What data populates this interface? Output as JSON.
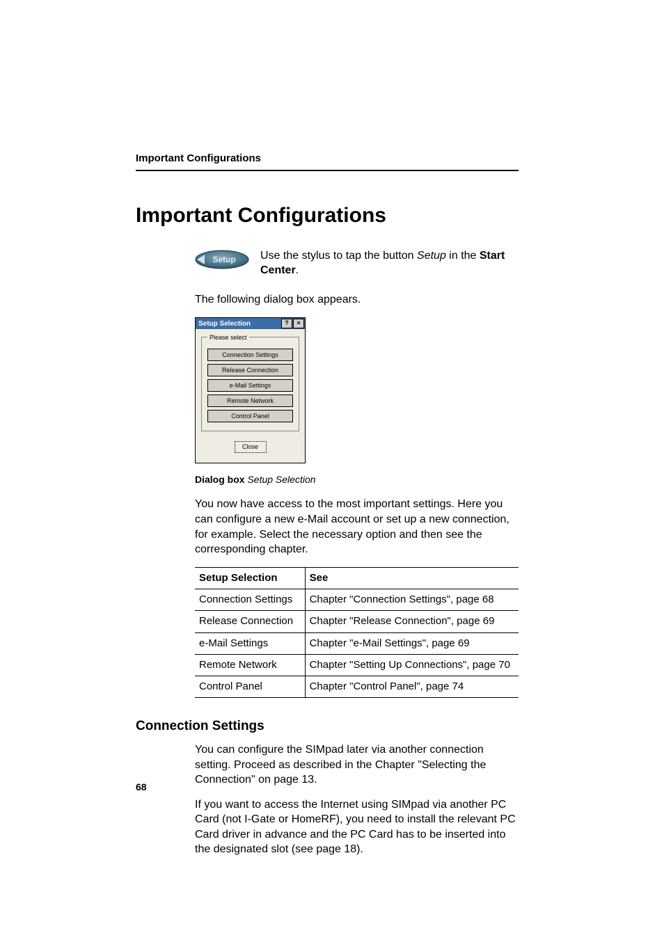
{
  "runningHead": "Important Configurations",
  "title": "Important Configurations",
  "setupButtonLabel": "Setup",
  "intro": {
    "line1a": "Use the stylus to tap the button ",
    "line1_em": "Setup",
    "line1b": " in the ",
    "line1_bold": "Start Center",
    "line1c": "."
  },
  "followingText": "The following dialog box appears.",
  "dialog": {
    "title": "Setup Selection",
    "help": "?",
    "close": "×",
    "legend": "Please select",
    "items": [
      "Connection Settings",
      "Release Connection",
      "e-Mail Settings",
      "Remote Network",
      "Control Panel"
    ],
    "closeBtn": "Close"
  },
  "caption": {
    "label": "Dialog box",
    "value": "Setup Selection"
  },
  "accessText": "You now have access to the most important settings. Here you can configure a new e-Mail account or set up a new connection, for example. Select the necessary option and then see the corresponding chapter.",
  "table": {
    "head": [
      "Setup Selection",
      "See"
    ],
    "rows": [
      [
        "Connection Settings",
        "Chapter \"Connection Settings\",  page 68"
      ],
      [
        "Release Connection",
        "Chapter \"Release Connection\",  page 69"
      ],
      [
        "e-Mail Settings",
        "Chapter \"e-Mail Settings\",  page 69"
      ],
      [
        "Remote Network",
        "Chapter \"Setting Up Connections\",  page 70"
      ],
      [
        "Control Panel",
        "Chapter \"Control Panel\",  page 74"
      ]
    ]
  },
  "sectionHeading": "Connection Settings",
  "sectionP1": "You can configure the SIMpad later via another connection setting. Proceed as described in the Chapter \"Selecting the Connection\" on page 13.",
  "sectionP2": "If you want to access the Internet using SIMpad via another PC Card (not I-Gate or HomeRF), you need to install the relevant PC Card driver in advance and the PC Card has to be inserted into the designated slot (see page 18).",
  "pageNumber": "68"
}
